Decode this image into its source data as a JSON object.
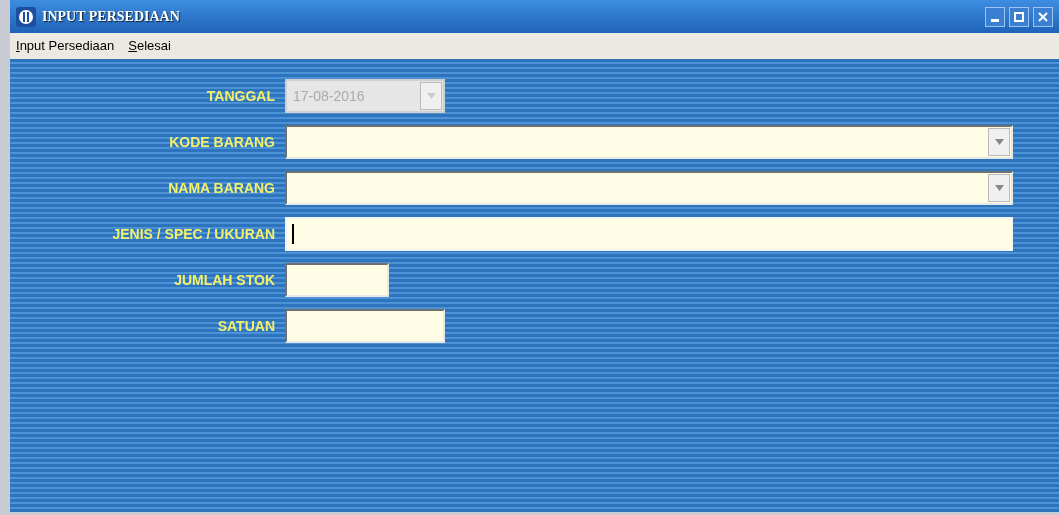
{
  "window": {
    "title": "INPUT PERSEDIAAN"
  },
  "menu": [
    {
      "label": "Input Persediaan"
    },
    {
      "label": "Selesai"
    }
  ],
  "fields": [
    {
      "label": "TANGGAL",
      "kind": "combo",
      "value": "17-08-2016",
      "disabled": true,
      "focused": false
    },
    {
      "label": "KODE BARANG",
      "kind": "combo",
      "disabled": false,
      "focused": false
    },
    {
      "label": "NAMA BARANG",
      "kind": "combo",
      "disabled": false,
      "focused": false
    },
    {
      "label": "JENIS / SPEC / UKURAN",
      "kind": "text",
      "disabled": false,
      "focused": true
    },
    {
      "label": "JUMLAH STOK",
      "kind": "text",
      "disabled": false,
      "focused": false
    },
    {
      "label": "SATUAN",
      "kind": "text",
      "disabled": false,
      "focused": false
    }
  ]
}
